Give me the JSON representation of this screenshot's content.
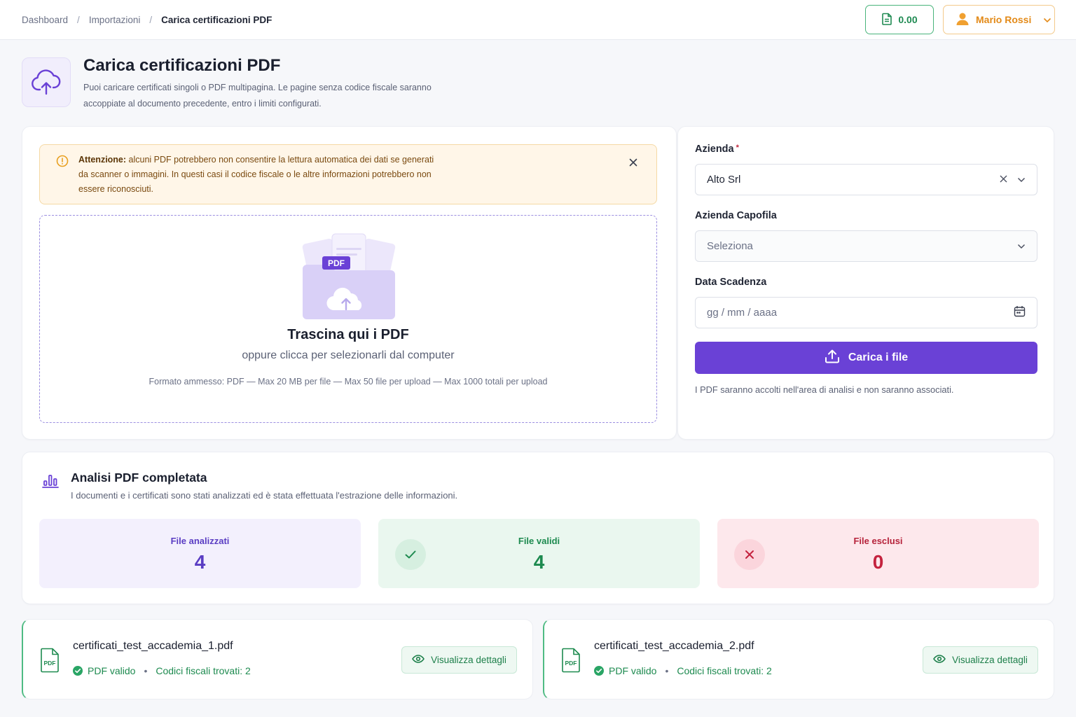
{
  "breadcrumb": [
    "Dashboard",
    "Importazioni",
    "Carica certificazioni PDF"
  ],
  "credits": {
    "value": "0.00",
    "icon": "document-icon",
    "color": "#1f8a52"
  },
  "user": {
    "name": "Mario Rossi",
    "icon": "user-icon",
    "color": "#e38a18"
  },
  "header": {
    "title": "Carica certificazioni PDF",
    "description": "Puoi caricare certificati singoli o PDF multipagina. Le pagine senza codice fiscale saranno accoppiate al documento precedente, entro i limiti configurati.",
    "icon": "cloud-upload-icon"
  },
  "alert": {
    "strong": "Attenzione:",
    "text": " alcuni PDF potrebbero non consentire la lettura automatica dei dati se generati da scanner o immagini. In questi casi il codice fiscale o le altre informazioni potrebbero non essere riconosciuti."
  },
  "dropzone": {
    "badge": "PDF",
    "title": "Trascina qui i PDF",
    "subtitle": "oppure clicca per selezionarli dal computer",
    "note": "Formato ammesso: PDF — Max 20 MB per file — Max 50 file per upload — Max 1000 totali per upload"
  },
  "form": {
    "azienda_label": "Azienda",
    "azienda_required": "*",
    "azienda_value": "Alto Srl",
    "capofila_label": "Azienda Capofila",
    "capofila_placeholder": "Seleziona",
    "scadenza_label": "Data Scadenza",
    "scadenza_placeholder": "gg / mm / aaaa",
    "submit_label": "Carica i file",
    "note": "I PDF saranno accolti nell'area di analisi e non saranno associati.",
    "accent": "#6a41d6"
  },
  "analysis": {
    "title": "Analisi PDF completata",
    "description": "I documenti e i certificati sono stati analizzati ed è stata effettuata l'estrazione delle informazioni.",
    "stats": [
      {
        "label": "File analizzati",
        "value": "4"
      },
      {
        "label": "File validi",
        "value": "4"
      },
      {
        "label": "File esclusi",
        "value": "0"
      }
    ]
  },
  "files": [
    {
      "name": "certificati_test_accademia_1.pdf",
      "status": "PDF valido",
      "dot": "•",
      "codes": "Codici fiscali trovati: 2",
      "action": "Visualizza dettagli",
      "icon_text": "PDF"
    },
    {
      "name": "certificati_test_accademia_2.pdf",
      "status": "PDF valido",
      "dot": "•",
      "codes": "Codici fiscali trovati: 2",
      "action": "Visualizza dettagli",
      "icon_text": "PDF"
    }
  ]
}
